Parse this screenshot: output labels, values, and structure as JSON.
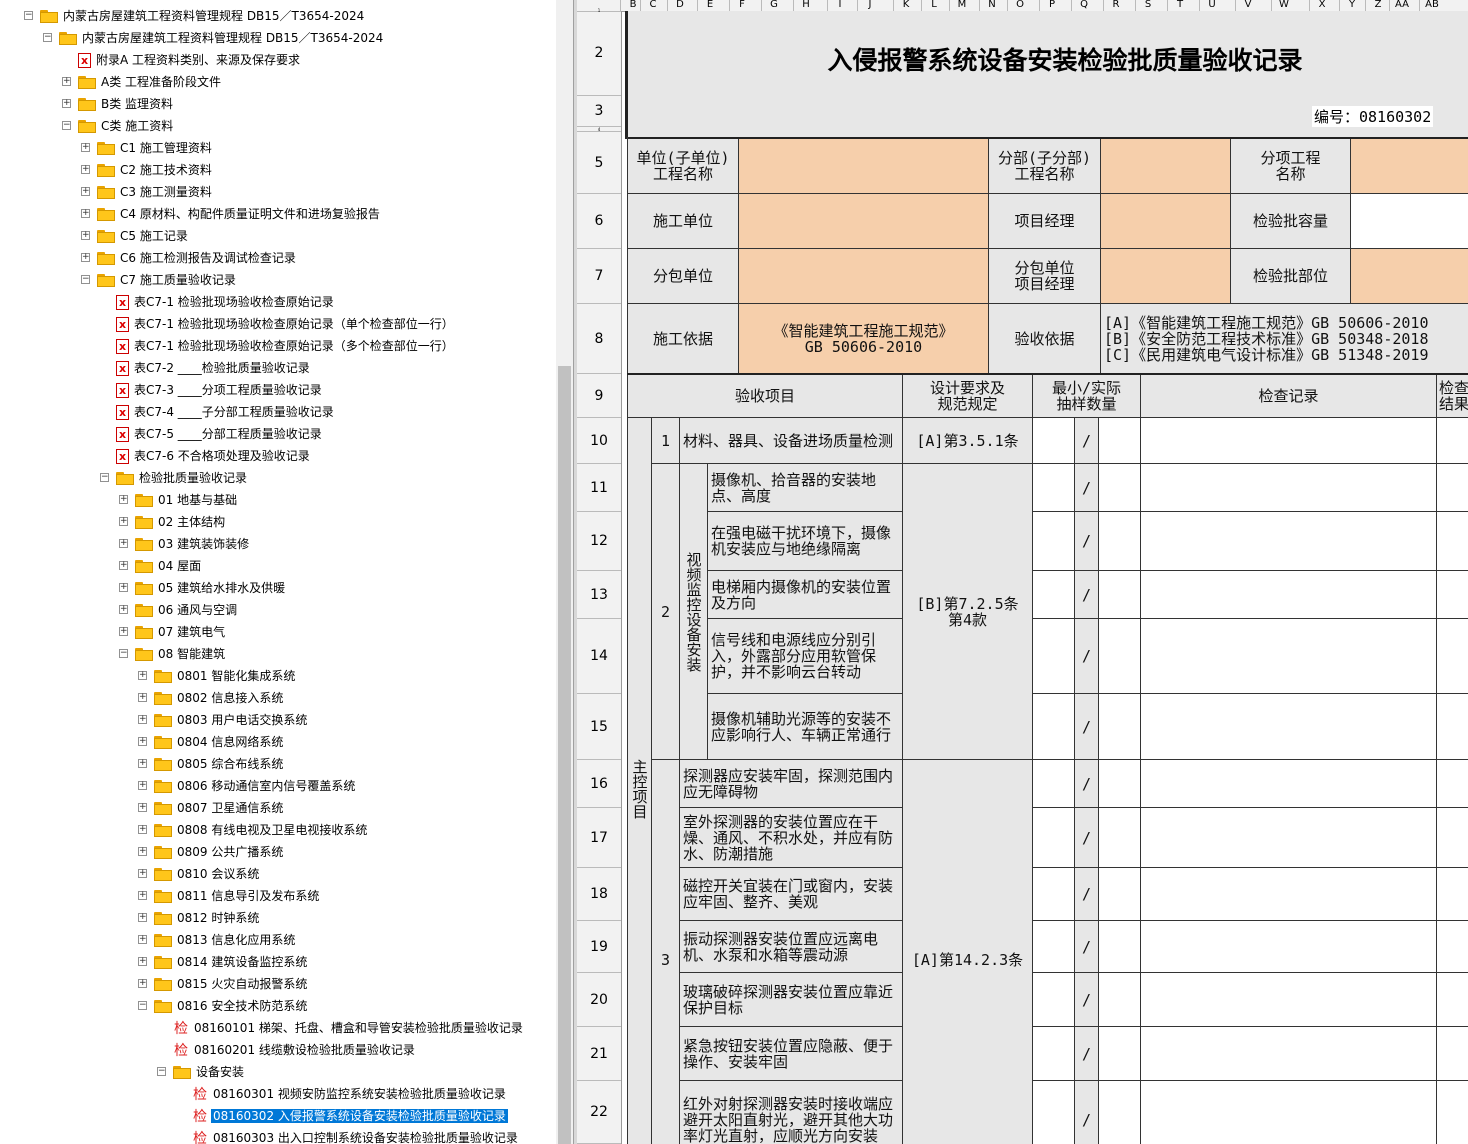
{
  "tree": {
    "nodes": [
      {
        "label": "内蒙古房屋建筑工程资料管理规程 DB15／T3654-2024",
        "depth": 0,
        "icon": "folder-open-icon",
        "toggle": "-"
      },
      {
        "label": "内蒙古房屋建筑工程资料管理规程 DB15／T3654-2024",
        "depth": 1,
        "icon": "folder-open-icon",
        "toggle": "-"
      },
      {
        "label": "附录A  工程资料类别、来源及保存要求",
        "depth": 2,
        "icon": "excel-file-icon",
        "toggle": ""
      },
      {
        "label": "A类 工程准备阶段文件",
        "depth": 2,
        "icon": "folder-icon",
        "toggle": "+"
      },
      {
        "label": "B类 监理资料",
        "depth": 2,
        "icon": "folder-icon",
        "toggle": "+"
      },
      {
        "label": "C类 施工资料",
        "depth": 2,
        "icon": "folder-open-icon",
        "toggle": "-"
      },
      {
        "label": "C1 施工管理资料",
        "depth": 3,
        "icon": "folder-icon",
        "toggle": "+"
      },
      {
        "label": "C2 施工技术资料",
        "depth": 3,
        "icon": "folder-icon",
        "toggle": "+"
      },
      {
        "label": "C3 施工测量资料",
        "depth": 3,
        "icon": "folder-icon",
        "toggle": "+"
      },
      {
        "label": "C4 原材料、构配件质量证明文件和进场复验报告",
        "depth": 3,
        "icon": "folder-icon",
        "toggle": "+"
      },
      {
        "label": "C5 施工记录",
        "depth": 3,
        "icon": "folder-icon",
        "toggle": "+"
      },
      {
        "label": "C6 施工检测报告及调试检查记录",
        "depth": 3,
        "icon": "folder-icon",
        "toggle": "+"
      },
      {
        "label": "C7 施工质量验收记录",
        "depth": 3,
        "icon": "folder-open-icon",
        "toggle": "-"
      },
      {
        "label": "表C7-1 检验批现场验收检查原始记录",
        "depth": 4,
        "icon": "excel-file-icon",
        "toggle": ""
      },
      {
        "label": "表C7-1 检验批现场验收检查原始记录（单个检查部位一行）",
        "depth": 4,
        "icon": "excel-file-icon",
        "toggle": ""
      },
      {
        "label": "表C7-1 检验批现场验收检查原始记录（多个检查部位一行）",
        "depth": 4,
        "icon": "excel-file-icon",
        "toggle": ""
      },
      {
        "label": "表C7-2 ____检验批质量验收记录",
        "depth": 4,
        "icon": "excel-file-icon",
        "toggle": ""
      },
      {
        "label": "表C7-3 ____分项工程质量验收记录",
        "depth": 4,
        "icon": "excel-file-icon",
        "toggle": ""
      },
      {
        "label": "表C7-4 ____子分部工程质量验收记录",
        "depth": 4,
        "icon": "excel-file-icon",
        "toggle": ""
      },
      {
        "label": "表C7-5 ____分部工程质量验收记录",
        "depth": 4,
        "icon": "excel-file-icon",
        "toggle": ""
      },
      {
        "label": "表C7-6 不合格项处理及验收记录",
        "depth": 4,
        "icon": "excel-file-icon",
        "toggle": ""
      },
      {
        "label": "检验批质量验收记录",
        "depth": 4,
        "icon": "folder-open-icon",
        "toggle": "-"
      },
      {
        "label": "01 地基与基础",
        "depth": 5,
        "icon": "folder-icon",
        "toggle": "+"
      },
      {
        "label": "02 主体结构",
        "depth": 5,
        "icon": "folder-icon",
        "toggle": "+"
      },
      {
        "label": "03 建筑装饰装修",
        "depth": 5,
        "icon": "folder-icon",
        "toggle": "+"
      },
      {
        "label": "04 屋面",
        "depth": 5,
        "icon": "folder-icon",
        "toggle": "+"
      },
      {
        "label": "05 建筑给水排水及供暖",
        "depth": 5,
        "icon": "folder-icon",
        "toggle": "+"
      },
      {
        "label": "06 通风与空调",
        "depth": 5,
        "icon": "folder-icon",
        "toggle": "+"
      },
      {
        "label": "07 建筑电气",
        "depth": 5,
        "icon": "folder-icon",
        "toggle": "+"
      },
      {
        "label": "08 智能建筑",
        "depth": 5,
        "icon": "folder-open-icon",
        "toggle": "-"
      },
      {
        "label": "0801 智能化集成系统",
        "depth": 6,
        "icon": "folder-icon",
        "toggle": "+"
      },
      {
        "label": "0802 信息接入系统",
        "depth": 6,
        "icon": "folder-icon",
        "toggle": "+"
      },
      {
        "label": "0803 用户电话交换系统",
        "depth": 6,
        "icon": "folder-icon",
        "toggle": "+"
      },
      {
        "label": "0804 信息网络系统",
        "depth": 6,
        "icon": "folder-icon",
        "toggle": "+"
      },
      {
        "label": "0805 综合布线系统",
        "depth": 6,
        "icon": "folder-icon",
        "toggle": "+"
      },
      {
        "label": "0806 移动通信室内信号覆盖系统",
        "depth": 6,
        "icon": "folder-icon",
        "toggle": "+"
      },
      {
        "label": "0807 卫星通信系统",
        "depth": 6,
        "icon": "folder-icon",
        "toggle": "+"
      },
      {
        "label": "0808 有线电视及卫星电视接收系统",
        "depth": 6,
        "icon": "folder-icon",
        "toggle": "+"
      },
      {
        "label": "0809 公共广播系统",
        "depth": 6,
        "icon": "folder-icon",
        "toggle": "+"
      },
      {
        "label": "0810 会议系统",
        "depth": 6,
        "icon": "folder-icon",
        "toggle": "+"
      },
      {
        "label": "0811 信息导引及发布系统",
        "depth": 6,
        "icon": "folder-icon",
        "toggle": "+"
      },
      {
        "label": "0812 时钟系统",
        "depth": 6,
        "icon": "folder-icon",
        "toggle": "+"
      },
      {
        "label": "0813 信息化应用系统",
        "depth": 6,
        "icon": "folder-icon",
        "toggle": "+"
      },
      {
        "label": "0814 建筑设备监控系统",
        "depth": 6,
        "icon": "folder-icon",
        "toggle": "+"
      },
      {
        "label": "0815 火灾自动报警系统",
        "depth": 6,
        "icon": "folder-icon",
        "toggle": "+"
      },
      {
        "label": "0816 安全技术防范系统",
        "depth": 6,
        "icon": "folder-open-icon",
        "toggle": "-"
      },
      {
        "label": "08160101 梯架、托盘、槽盒和导管安装检验批质量验收记录",
        "depth": 7,
        "icon": "jian-icon",
        "toggle": ""
      },
      {
        "label": "08160201 线缆敷设检验批质量验收记录",
        "depth": 7,
        "icon": "jian-icon",
        "toggle": ""
      },
      {
        "label": "设备安装",
        "depth": 7,
        "icon": "folder-open-icon",
        "toggle": "-"
      },
      {
        "label": "08160301 视频安防监控系统安装检验批质量验收记录",
        "depth": 8,
        "icon": "jian-icon",
        "toggle": ""
      },
      {
        "label": "08160302 入侵报警系统设备安装检验批质量验收记录",
        "depth": 8,
        "icon": "jian-icon",
        "toggle": "",
        "selected": true
      },
      {
        "label": "08160303 出入口控制系统设备安装检验批质量验收记录",
        "depth": 8,
        "icon": "jian-icon",
        "toggle": ""
      }
    ]
  },
  "sheet": {
    "columns": [
      "B",
      "C",
      "D",
      "E",
      "F",
      "G",
      "H",
      "I",
      "J",
      "K",
      "L",
      "M",
      "N",
      "O",
      "P",
      "Q",
      "R",
      "S",
      "T",
      "U",
      "V",
      "W",
      "X",
      "Y",
      "Z",
      "AA",
      "AB"
    ],
    "rows": [
      "1",
      "2",
      "3",
      "4",
      "5",
      "6",
      "7",
      "8",
      "9",
      "10",
      "11",
      "12",
      "13",
      "14",
      "15",
      "16",
      "17",
      "18",
      "19",
      "20",
      "21",
      "22"
    ],
    "title": "入侵报警系统设备安装检验批质量验收记录",
    "code": "编号：08160302",
    "header": {
      "unit_label": "单位(子单位)\n工程名称",
      "subdiv_label": "分部(子分部)\n工程名称",
      "item_label": "分项工程\n名称",
      "constructor_label": "施工单位",
      "pm_label": "项目经理",
      "capacity_label": "检验批容量",
      "subcontractor_label": "分包单位",
      "sub_pm_label": "分包单位\n项目经理",
      "location_label": "检验批部位",
      "basis_label": "施工依据",
      "basis_value": "《智能建筑工程施工规范》\nGB 50606-2010",
      "accept_basis_label": "验收依据",
      "accept_basis_value": "[A]《智能建筑工程施工规范》GB 50606-2010\n[B]《安全防范工程技术标准》GB 50348-2018\n[C]《民用建筑电气设计标准》GB 51348-2019"
    },
    "table_head": {
      "items": "验收项目",
      "design": "设计要求及\n规范规定",
      "sample": "最小/实际\n抽样数量",
      "record": "检查记录",
      "result": "检查\n结果"
    },
    "main_control": "主控项目",
    "group1": {
      "no": "1",
      "text": "材料、器具、设备进场质量检测",
      "spec": "[A]第3.5.1条"
    },
    "group2": {
      "no": "2",
      "label": "视频监控设备安装",
      "spec": "[B]第7.2.5条\n第4款",
      "items": [
        "摄像机、拾音器的安装地点、高度",
        "在强电磁干扰环境下，摄像机安装应与地绝缘隔离",
        "电梯厢内摄像机的安装位置及方向",
        "信号线和电源线应分别引入，外露部分应用软管保护，并不影响云台转动",
        "摄像机辅助光源等的安装不应影响行人、车辆正常通行"
      ]
    },
    "group3": {
      "no": "3",
      "spec": "[A]第14.2.3条",
      "items": [
        "探测器应安装牢固，探测范围内应无障碍物",
        "室外探测器的安装位置应在干燥、通风、不积水处，并应有防水、防潮措施",
        "磁控开关宜装在门或窗内，安装应牢固、整齐、美观",
        "振动探测器安装位置应远离电机、水泵和水箱等震动源",
        "玻璃破碎探测器安装位置应靠近保护目标",
        "紧急按钮安装位置应隐蔽、便于操作、安装牢固",
        "红外对射探测器安装时接收端应避开太阳直射光，避开其他大功率灯光直射，应顺光方向安装"
      ]
    },
    "slash": "/"
  }
}
